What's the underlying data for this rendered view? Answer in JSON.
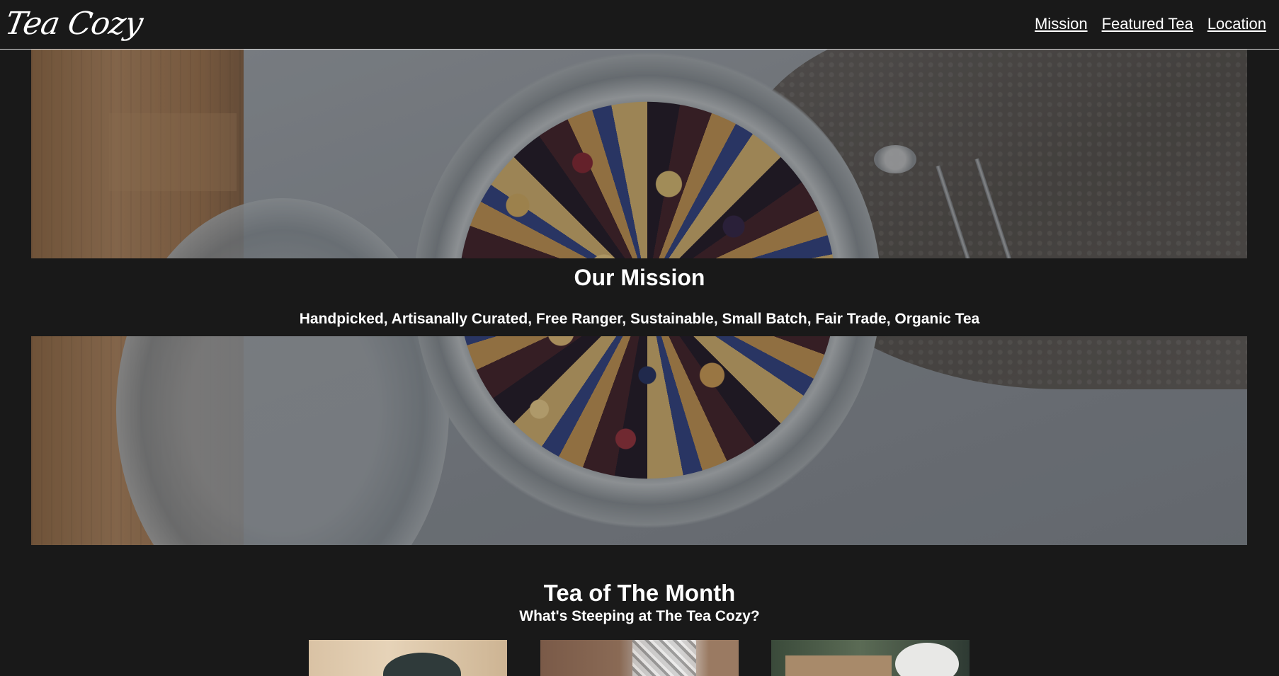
{
  "header": {
    "logo_text": "Tea Cozy",
    "nav": {
      "mission": "Mission",
      "featured_tea": "Featured Tea",
      "location": "Location"
    }
  },
  "mission": {
    "title": "Our Mission",
    "tagline": "Handpicked, Artisanally Curated, Free Ranger, Sustainable, Small Batch, Fair Trade, Organic Tea"
  },
  "tea_of_month": {
    "title": "Tea of The Month",
    "subtitle": "What's Steeping at The Tea Cozy?"
  },
  "colors": {
    "background": "#191919",
    "text": "#ffffff",
    "header_border": "#d9d9d9"
  }
}
